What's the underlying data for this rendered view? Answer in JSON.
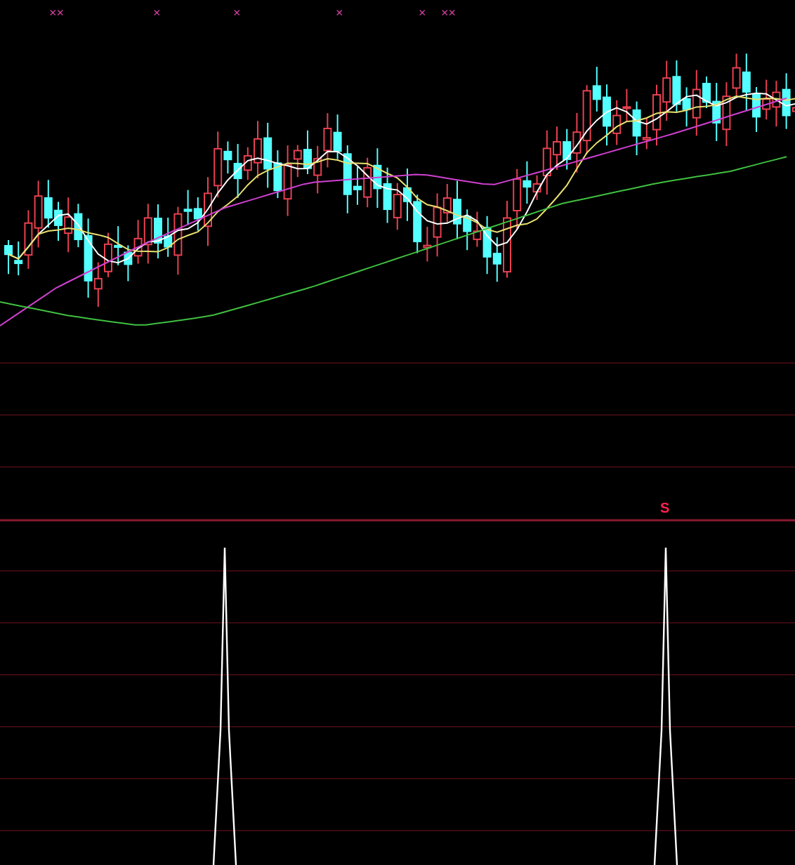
{
  "top_markers": [
    {
      "text": "××"
    },
    {
      "text": "×"
    },
    {
      "text": "×"
    },
    {
      "text": "×"
    },
    {
      "text": "×"
    },
    {
      "text": "××"
    }
  ],
  "signal_marker": {
    "text": "S"
  }
}
